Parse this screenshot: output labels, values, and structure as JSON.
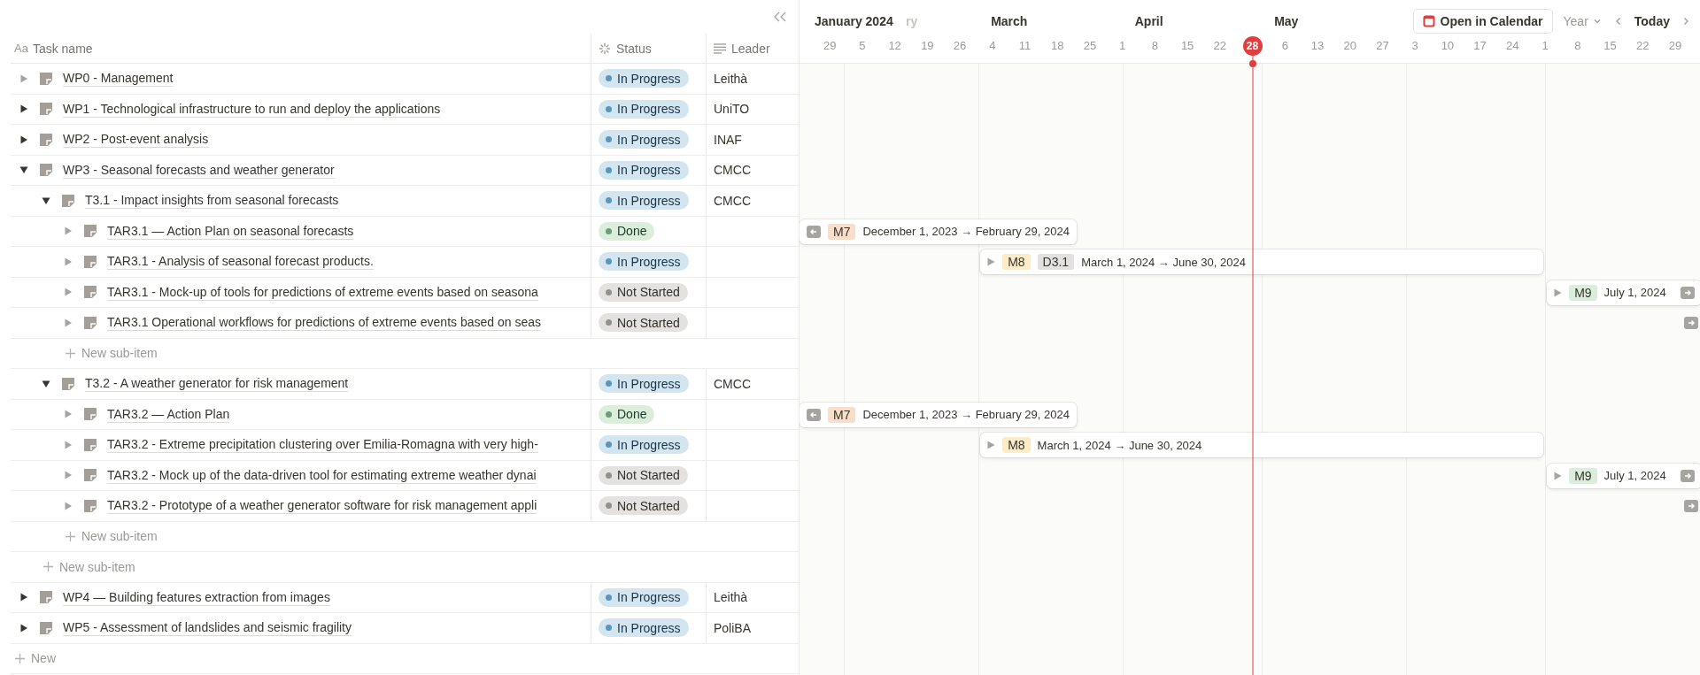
{
  "table": {
    "columns": [
      {
        "kind": "title",
        "icon_text": "Aa",
        "label": "Task name"
      },
      {
        "kind": "status",
        "label": "Status"
      },
      {
        "kind": "text",
        "label": "Leader"
      }
    ],
    "items": [
      {
        "name": "WP0 - Management",
        "expanded": false,
        "has_subitems": false,
        "status": {
          "label": "In Progress",
          "kind": "in_progress"
        },
        "leader": "Leithà"
      },
      {
        "name": "WP1 - Technological infrastructure to run and deploy the applications",
        "expanded": false,
        "has_subitems": true,
        "status": {
          "label": "In Progress",
          "kind": "in_progress"
        },
        "leader": "UniTO"
      },
      {
        "name": "WP2 - Post-event analysis",
        "expanded": false,
        "has_subitems": true,
        "status": {
          "label": "In Progress",
          "kind": "in_progress"
        },
        "leader": "INAF"
      },
      {
        "name": "WP3 - Seasonal forecasts and weather generator",
        "expanded": true,
        "has_subitems": true,
        "status": {
          "label": "In Progress",
          "kind": "in_progress"
        },
        "leader": "CMCC",
        "add_label": "New sub-item",
        "children": [
          {
            "name": "T3.1 - Impact insights from seasonal forecasts",
            "expanded": true,
            "has_subitems": true,
            "status": {
              "label": "In Progress",
              "kind": "in_progress"
            },
            "leader": "CMCC",
            "add_label": "New sub-item",
            "children": [
              {
                "name": "TAR3.1 — Action Plan on seasonal forecasts",
                "expanded": false,
                "has_subitems": false,
                "status": {
                  "label": "Done",
                  "kind": "done"
                },
                "bar": {
                  "kind": "bar",
                  "tags": [
                    {
                      "label": "M7",
                      "color": "#fadec9"
                    }
                  ],
                  "start": "December 1, 2023",
                  "arrow": "→",
                  "end": "February 29, 2024"
                }
              },
              {
                "name": "TAR3.1 - Analysis of seasonal forecast products.",
                "expanded": false,
                "has_subitems": false,
                "status": {
                  "label": "In Progress",
                  "kind": "in_progress"
                },
                "bar": {
                  "kind": "bar",
                  "tags": [
                    {
                      "label": "M8",
                      "color": "#fdecc8"
                    },
                    {
                      "label": "D3.1",
                      "color": "#e3e2e0"
                    }
                  ],
                  "start": "March 1, 2024",
                  "arrow": "→",
                  "end": "June 30, 2024"
                }
              },
              {
                "name": "TAR3.1 - Mock-up of tools for predictions of extreme events based on seasona",
                "expanded": false,
                "has_subitems": false,
                "status": {
                  "label": "Not Started",
                  "kind": "not_started"
                },
                "bar": {
                  "kind": "bar",
                  "tags": [
                    {
                      "label": "M9",
                      "color": "#dbeddb"
                    }
                  ],
                  "start": "July 1, 2024"
                }
              },
              {
                "name": "TAR3.1 Operational workflows for predictions of extreme events based on seas",
                "expanded": false,
                "has_subitems": false,
                "status": {
                  "label": "Not Started",
                  "kind": "not_started"
                },
                "bar": {
                  "kind": "offscreen"
                }
              }
            ]
          },
          {
            "name": "T3.2 - A weather generator for risk management",
            "expanded": true,
            "has_subitems": true,
            "status": {
              "label": "In Progress",
              "kind": "in_progress"
            },
            "leader": "CMCC",
            "add_label": "New sub-item",
            "children": [
              {
                "name": "TAR3.2 — Action Plan",
                "expanded": false,
                "has_subitems": false,
                "status": {
                  "label": "Done",
                  "kind": "done"
                },
                "bar": {
                  "kind": "bar",
                  "tags": [
                    {
                      "label": "M7",
                      "color": "#fadec9"
                    }
                  ],
                  "start": "December 1, 2023",
                  "arrow": "→",
                  "end": "February 29, 2024"
                }
              },
              {
                "name": "TAR3.2 - Extreme precipitation clustering over Emilia-Romagna with very high-",
                "expanded": false,
                "has_subitems": false,
                "status": {
                  "label": "In Progress",
                  "kind": "in_progress"
                },
                "bar": {
                  "kind": "bar",
                  "tags": [
                    {
                      "label": "M8",
                      "color": "#fdecc8"
                    }
                  ],
                  "start": "March 1, 2024",
                  "arrow": "→",
                  "end": "June 30, 2024"
                }
              },
              {
                "name": "TAR3.2 - Mock up of the data-driven tool for estimating extreme weather dynai",
                "expanded": false,
                "has_subitems": false,
                "status": {
                  "label": "Not Started",
                  "kind": "not_started"
                },
                "bar": {
                  "kind": "bar",
                  "tags": [
                    {
                      "label": "M9",
                      "color": "#dbeddb"
                    }
                  ],
                  "start": "July 1, 2024"
                }
              },
              {
                "name": "TAR3.2 - Prototype of a weather generator software for risk management appli",
                "expanded": false,
                "has_subitems": false,
                "status": {
                  "label": "Not Started",
                  "kind": "not_started"
                },
                "bar": {
                  "kind": "offscreen"
                }
              }
            ]
          }
        ]
      },
      {
        "name": "WP4 — Building features extraction from images",
        "expanded": false,
        "has_subitems": true,
        "status": {
          "label": "In Progress",
          "kind": "in_progress"
        },
        "leader": "Leithà"
      },
      {
        "name": "WP5 - Assessment of landslides and seismic fragility",
        "expanded": false,
        "has_subitems": true,
        "status": {
          "label": "In Progress",
          "kind": "in_progress"
        },
        "leader": "PoliBA"
      }
    ],
    "add_label": "New"
  },
  "timeline": {
    "months": [
      {
        "label": "January 2024",
        "kind": "sticky"
      },
      {
        "label": "ry",
        "kind": "cut"
      },
      {
        "label": "March",
        "kind": "month"
      },
      {
        "label": "April",
        "kind": "month"
      },
      {
        "label": "May",
        "kind": "month"
      }
    ],
    "weeks": [
      {
        "label": "29",
        "today": false
      },
      {
        "label": "5",
        "today": false
      },
      {
        "label": "12",
        "today": false
      },
      {
        "label": "19",
        "today": false
      },
      {
        "label": "26",
        "today": false
      },
      {
        "label": "4",
        "today": false
      },
      {
        "label": "11",
        "today": false
      },
      {
        "label": "18",
        "today": false
      },
      {
        "label": "25",
        "today": false
      },
      {
        "label": "1",
        "today": false
      },
      {
        "label": "8",
        "today": false
      },
      {
        "label": "15",
        "today": false
      },
      {
        "label": "22",
        "today": false
      },
      {
        "label": "28",
        "today": true
      },
      {
        "label": "6",
        "today": false
      },
      {
        "label": "13",
        "today": false
      },
      {
        "label": "20",
        "today": false
      },
      {
        "label": "27",
        "today": false
      },
      {
        "label": "3",
        "today": false
      },
      {
        "label": "10",
        "today": false
      },
      {
        "label": "17",
        "today": false
      },
      {
        "label": "24",
        "today": false
      },
      {
        "label": "1",
        "today": false
      },
      {
        "label": "8",
        "today": false
      },
      {
        "label": "15",
        "today": false
      },
      {
        "label": "22",
        "today": false
      },
      {
        "label": "29",
        "today": false
      }
    ],
    "open_calendar": "Open in Calendar",
    "range": "Year",
    "today_label": "Today"
  }
}
